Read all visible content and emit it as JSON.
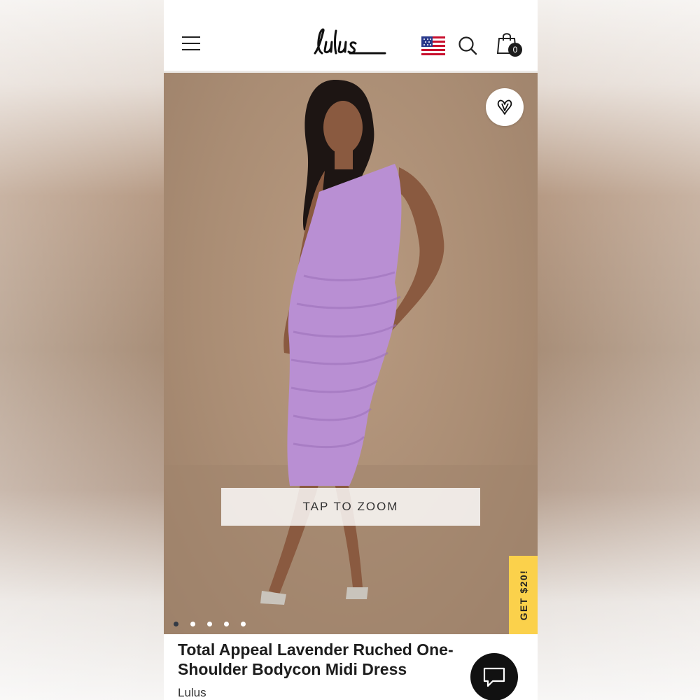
{
  "header": {
    "menu_icon": "hamburger-menu-icon",
    "logo_text": "Lulus",
    "flag_icon": "us-flag-icon",
    "search_icon": "search-icon",
    "bag_icon": "shopping-bag-icon",
    "bag_count": "0"
  },
  "gallery": {
    "favorite_icon": "heart-icon",
    "zoom_label": "TAP TO ZOOM",
    "image_count": 5,
    "active_index": 0,
    "promo_label": "GET $20!"
  },
  "product": {
    "title": "Total Appeal Lavender Ruched One-Shoulder Bodycon Midi Dress",
    "brand": "Lulus"
  },
  "chat": {
    "icon": "chat-bubble-icon"
  },
  "colors": {
    "accent_yellow": "#fbd14b",
    "dress_lavender": "#b98fd3",
    "backdrop_tan": "#aa8d74",
    "text_dark": "#1d1d1d"
  }
}
